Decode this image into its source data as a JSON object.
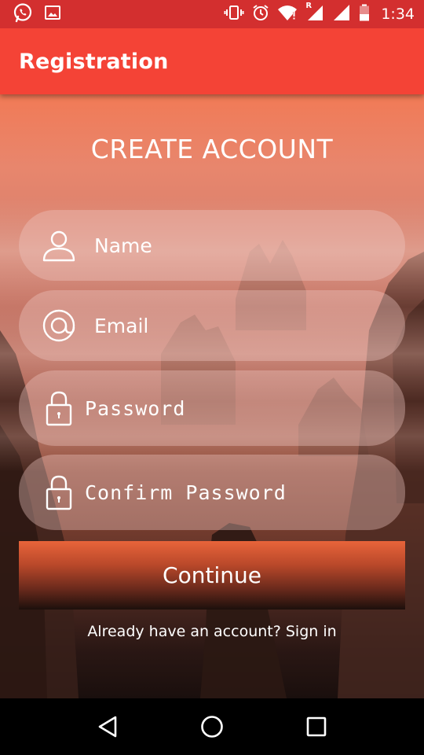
{
  "status_bar": {
    "time": "1:34",
    "left_icons": [
      "whatsapp-icon",
      "gallery-icon"
    ],
    "right_icons": [
      "vibrate-icon",
      "alarm-icon",
      "wifi-icon",
      "signal-roaming-icon",
      "signal-icon",
      "battery-icon"
    ],
    "roaming_label": "R"
  },
  "app_bar": {
    "title": "Registration",
    "color": "#f44336",
    "status_color": "#d32f2f"
  },
  "form": {
    "heading": "CREATE ACCOUNT",
    "fields": {
      "name": {
        "placeholder": "Name",
        "icon": "person-icon"
      },
      "email": {
        "placeholder": "Email",
        "icon": "at-sign-icon"
      },
      "password": {
        "placeholder": "Password",
        "icon": "lock-icon"
      },
      "confirm_password": {
        "placeholder": "Confirm Password",
        "icon": "lock-icon"
      }
    },
    "continue_label": "Continue",
    "signin_text": "Already have an account? Sign in"
  },
  "nav_bar": {
    "buttons": [
      "back-triangle-icon",
      "home-circle-icon",
      "recents-square-icon"
    ]
  }
}
